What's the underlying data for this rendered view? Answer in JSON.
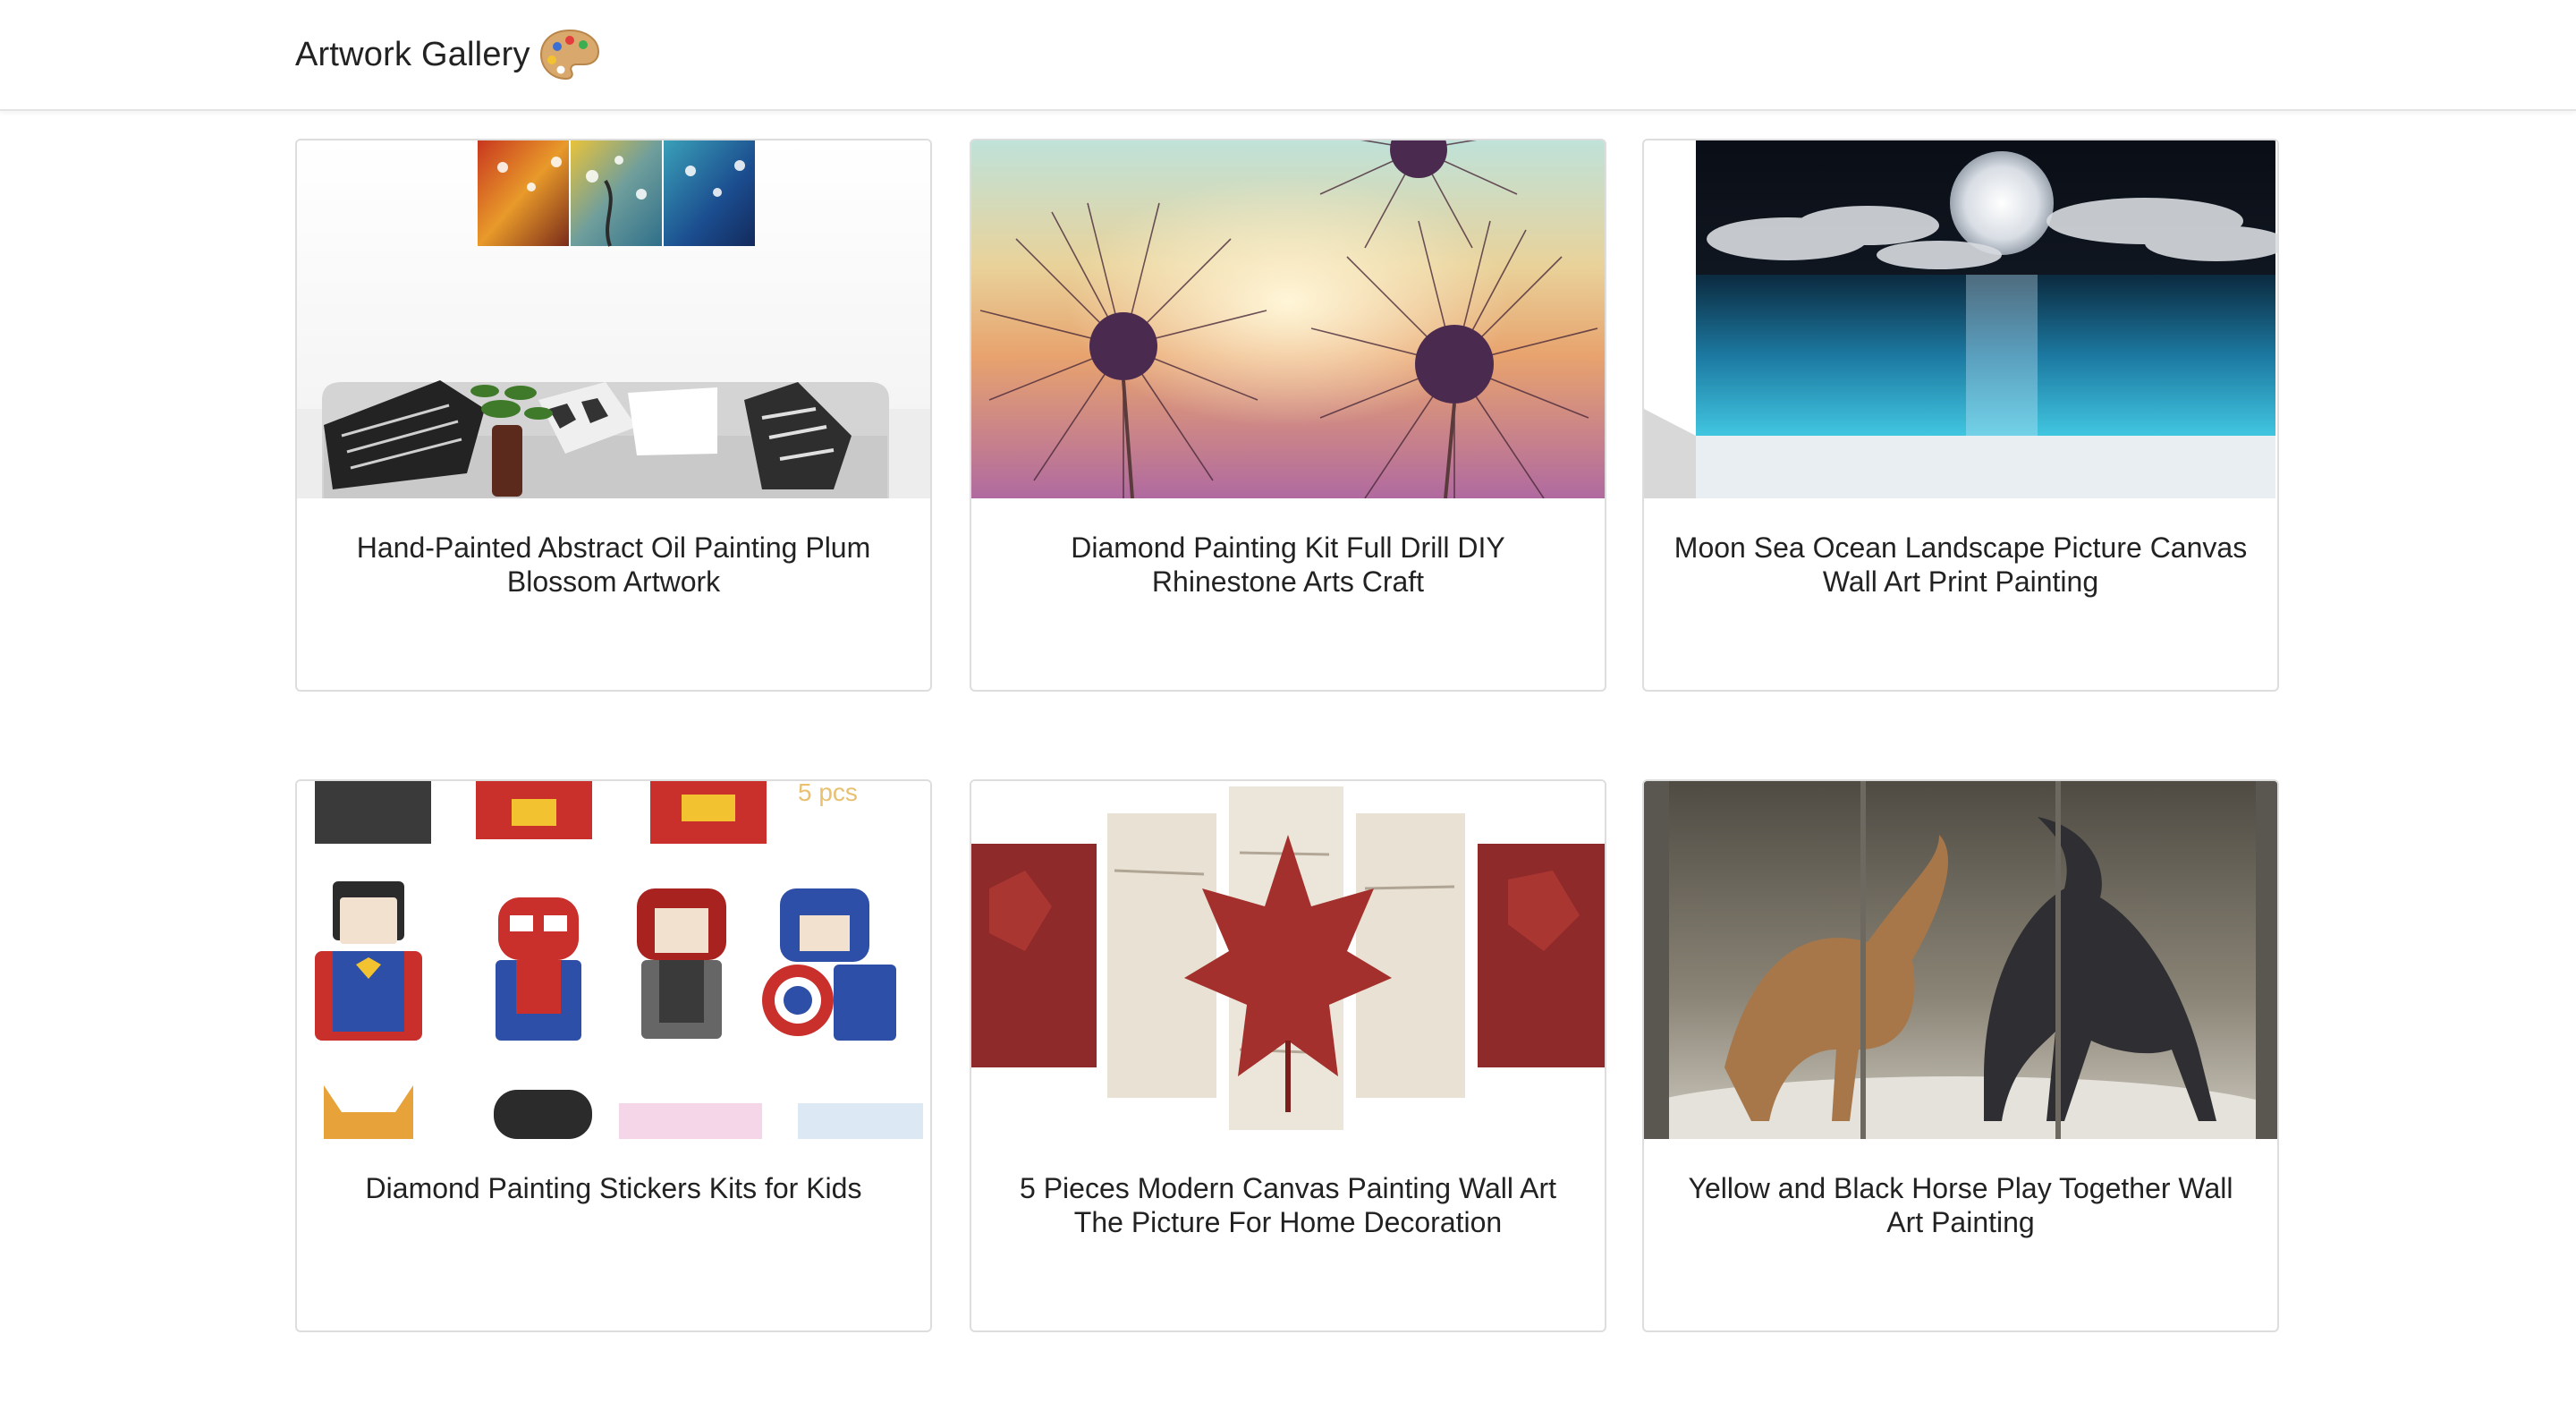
{
  "header": {
    "brand_title": "Artwork Gallery",
    "brand_icon": "artist-palette-icon"
  },
  "colors": {
    "navbar_bg": "#ffffff",
    "card_border": "#dddddd",
    "text": "#222222"
  },
  "gallery": {
    "items": [
      {
        "title": "Hand-Painted Abstract Oil Painting Plum Blossom Artwork",
        "image": "plum-blossom-triptych-above-sofa"
      },
      {
        "title": "Diamond Painting Kit Full Drill DIY Rhinestone Arts Craft",
        "image": "dandelion-sunset"
      },
      {
        "title": "Moon Sea Ocean Landscape Picture Canvas Wall Art Print Painting",
        "image": "full-moon-over-sea"
      },
      {
        "title": "Diamond Painting Stickers Kits for Kids",
        "image": "superhero-pixel-stickers"
      },
      {
        "title": "5 Pieces Modern Canvas Painting Wall Art The Picture For Home Decoration",
        "image": "maple-leaf-birch-panels"
      },
      {
        "title": "Yellow and Black Horse Play Together Wall Art Painting",
        "image": "two-horses-triptych"
      }
    ]
  }
}
